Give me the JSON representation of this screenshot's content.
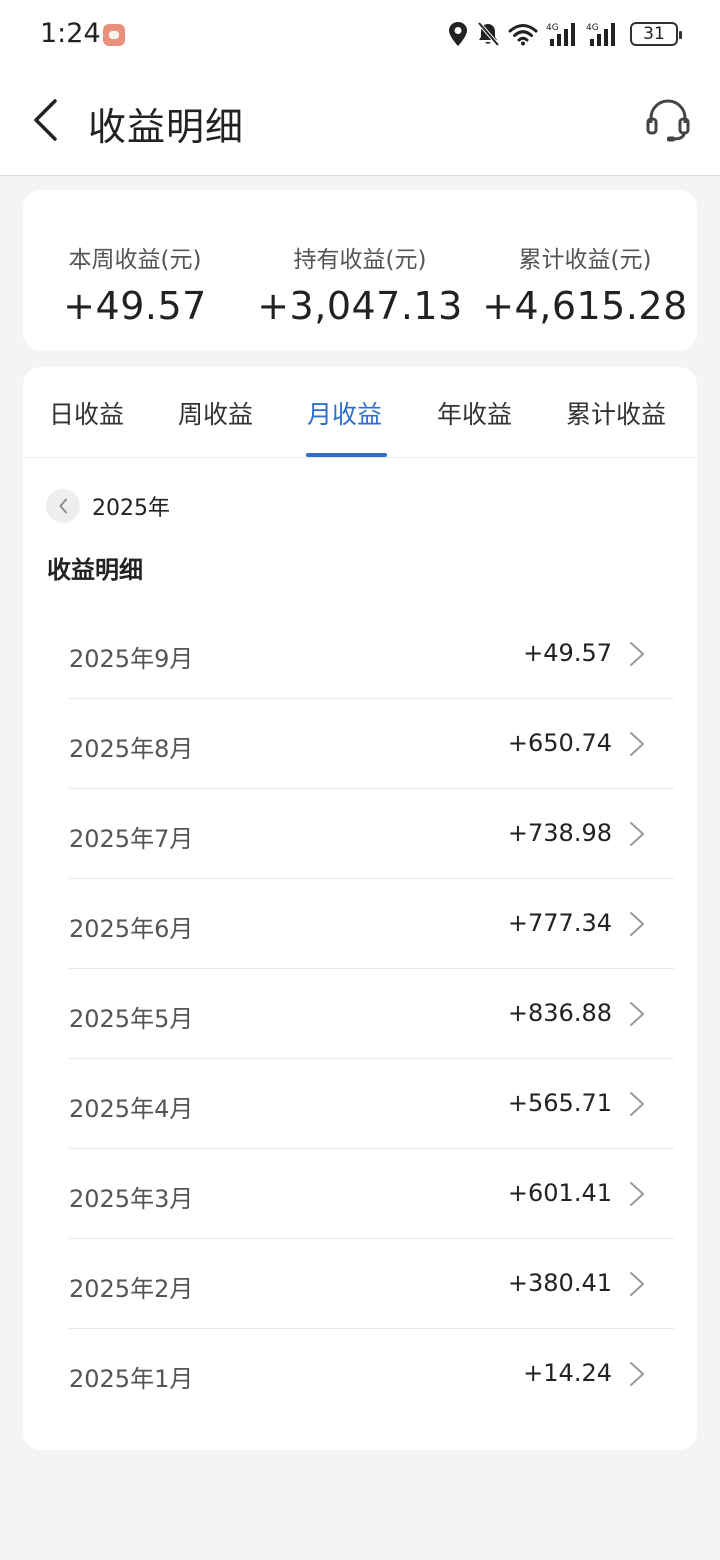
{
  "status_bar": {
    "time": "1:24",
    "battery": "31"
  },
  "header": {
    "title": "收益明细"
  },
  "summary": [
    {
      "label": "本周收益(元)",
      "value": "+49.57"
    },
    {
      "label": "持有收益(元)",
      "value": "+3,047.13"
    },
    {
      "label": "累计收益(元)",
      "value": "+4,615.28"
    }
  ],
  "tabs": [
    {
      "label": "日收益",
      "active": false
    },
    {
      "label": "周收益",
      "active": false
    },
    {
      "label": "月收益",
      "active": true
    },
    {
      "label": "年收益",
      "active": false
    },
    {
      "label": "累计收益",
      "active": false
    }
  ],
  "year_selector": {
    "label": "2025年"
  },
  "section_title": "收益明细",
  "months": [
    {
      "label": "2025年9月",
      "value": "+49.57"
    },
    {
      "label": "2025年8月",
      "value": "+650.74"
    },
    {
      "label": "2025年7月",
      "value": "+738.98"
    },
    {
      "label": "2025年6月",
      "value": "+777.34"
    },
    {
      "label": "2025年5月",
      "value": "+836.88"
    },
    {
      "label": "2025年4月",
      "value": "+565.71"
    },
    {
      "label": "2025年3月",
      "value": "+601.41"
    },
    {
      "label": "2025年2月",
      "value": "+380.41"
    },
    {
      "label": "2025年1月",
      "value": "+14.24"
    }
  ],
  "colors": {
    "accent": "#2d6fcf",
    "background": "#f4f4f4",
    "card": "#ffffff"
  }
}
